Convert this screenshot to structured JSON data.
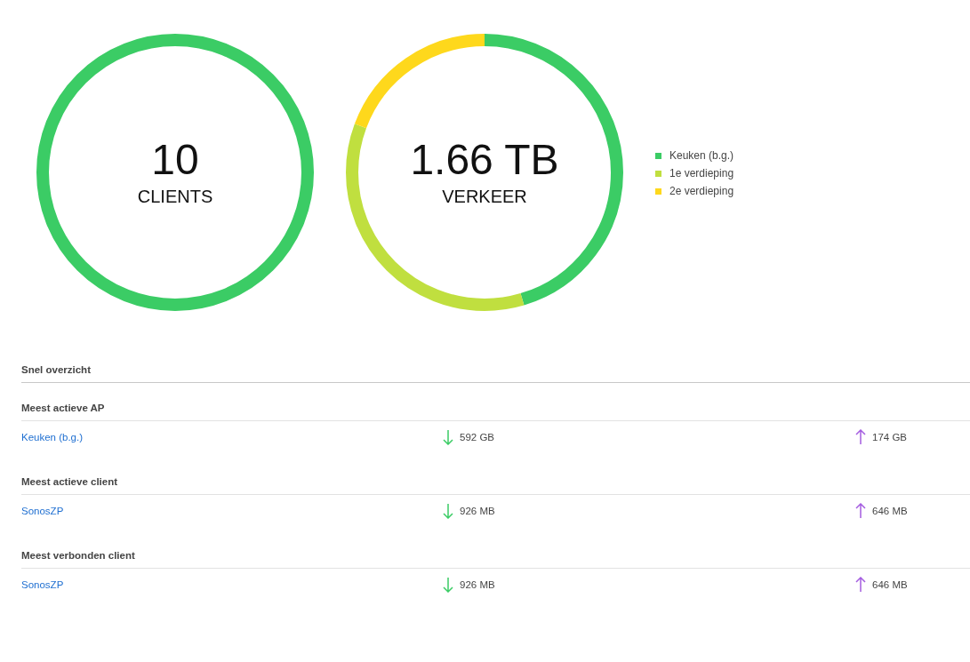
{
  "summary": {
    "clients": {
      "value": "10",
      "label": "CLIENTS"
    },
    "traffic": {
      "value": "1.66 TB",
      "label": "VERKEER"
    }
  },
  "legend": [
    {
      "label": "Keuken (b.g.)",
      "color": "#3bcc65"
    },
    {
      "label": "1e verdieping",
      "color": "#c0df3f"
    },
    {
      "label": "2e verdieping",
      "color": "#fed81c"
    }
  ],
  "overview": {
    "title": "Snel overzicht",
    "groups": [
      {
        "title": "Meest actieve AP",
        "name": "Keuken (b.g.)",
        "download": "592 GB",
        "upload": "174 GB"
      },
      {
        "title": "Meest actieve client",
        "name": "SonosZP",
        "download": "926 MB",
        "upload": "646 MB"
      },
      {
        "title": "Meest verbonden client",
        "name": "SonosZP",
        "download": "926 MB",
        "upload": "646 MB"
      }
    ]
  }
}
